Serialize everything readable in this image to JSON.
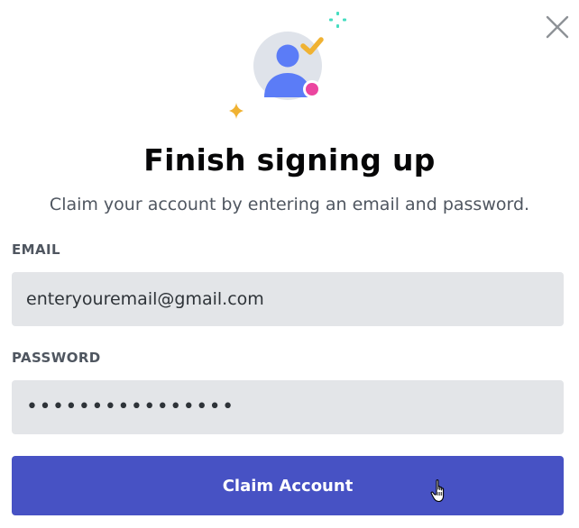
{
  "dialog": {
    "title": "Finish signing up",
    "subtitle": "Claim your account by entering an email and password."
  },
  "close_button": {
    "icon": "close-icon"
  },
  "illustration": {
    "icon": "user-avatar-icon",
    "accents": [
      "checkmark-icon",
      "status-dot-icon",
      "sparkle-icon",
      "twinkle-icon"
    ]
  },
  "email": {
    "label": "EMAIL",
    "value": "enteryouremail@gmail.com"
  },
  "password": {
    "label": "PASSWORD",
    "masked_value": "••••••••••••••••"
  },
  "submit": {
    "label": "Claim Account"
  },
  "colors": {
    "primary_button": "#4752c4",
    "input_background": "#e3e5e8",
    "heading_text": "#060607",
    "muted_text": "#4f5660",
    "avatar_blue": "#5b7cf7",
    "avatar_bg": "#dfe3ea",
    "check_yellow": "#f0b232",
    "status_pink": "#eb459f",
    "sparkle_cyan": "#45ddc0",
    "close_gray": "#8e9297"
  }
}
